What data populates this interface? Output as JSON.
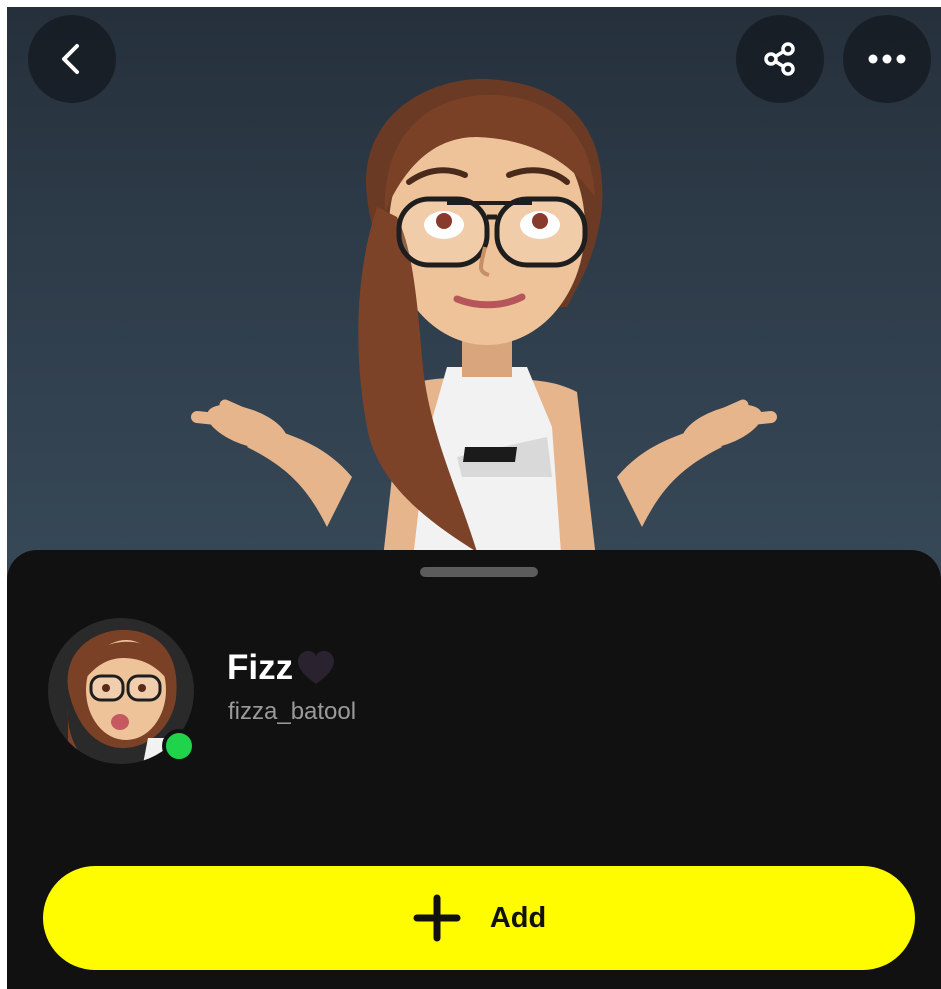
{
  "header": {
    "back_icon": "chevron-left-icon",
    "share_icon": "share-icon",
    "more_icon": "more-horizontal-icon"
  },
  "profile": {
    "display_name": "Fizz",
    "name_emoji": "black-heart-icon",
    "username": "fizza_batool",
    "online": true
  },
  "actions": {
    "add_label": "Add",
    "add_icon": "plus-icon"
  },
  "colors": {
    "accent_yellow": "#fffc00",
    "sheet_background": "#111111",
    "online_green": "#1fd34a",
    "hero_background": "#2f3d4b"
  }
}
